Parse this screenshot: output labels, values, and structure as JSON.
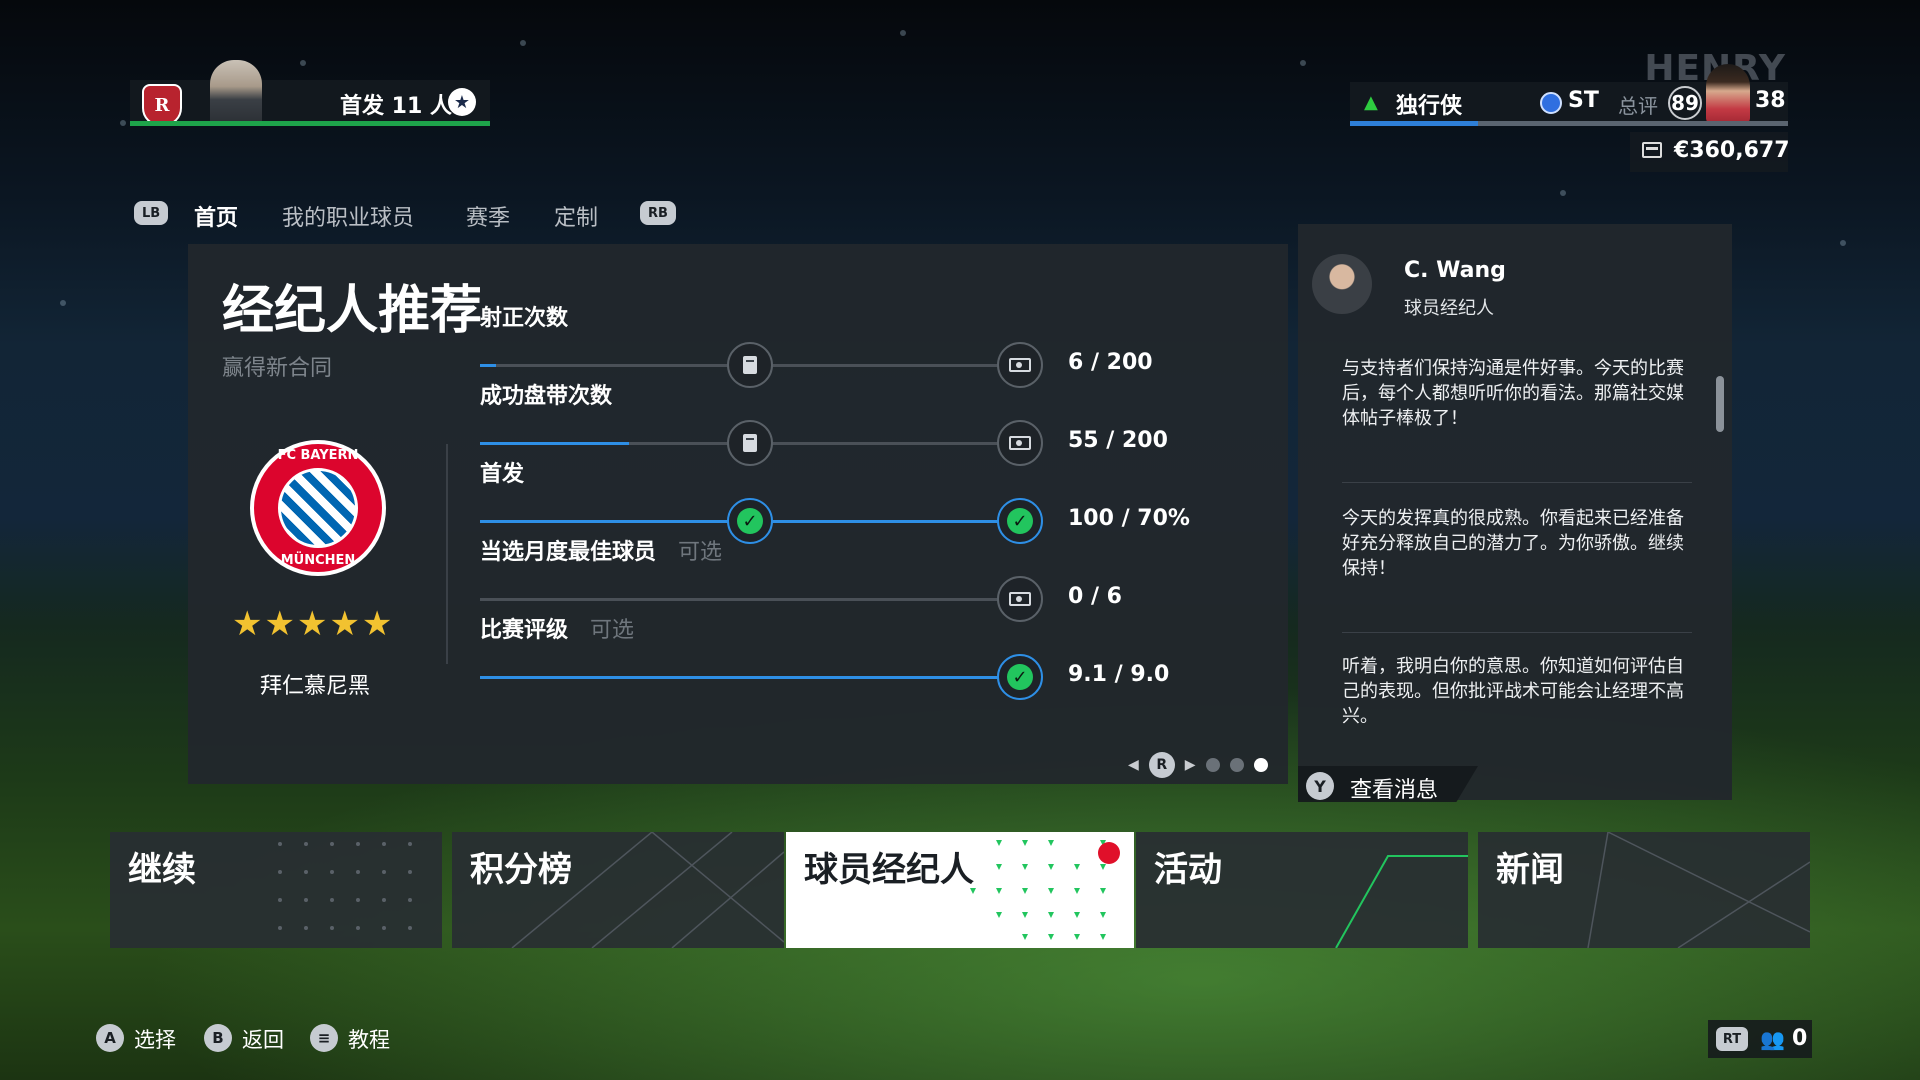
{
  "top_left": {
    "club_crest_text": "R",
    "squad_label": "首发 11 人"
  },
  "top_right": {
    "player_name": "HENRY",
    "archetype": "独行侠",
    "position": "ST",
    "ovr_label": "总评",
    "ovr_value": "89",
    "age": "38",
    "wallet": "€360,677"
  },
  "nav": {
    "lb": "LB",
    "rb": "RB",
    "tabs": [
      "首页",
      "我的职业球员",
      "赛季",
      "定制"
    ]
  },
  "objectives_panel": {
    "title": "经纪人推荐",
    "subtitle": "赢得新合同",
    "club_name": "拜仁慕尼黑",
    "club_logo_top": "FC BAYERN",
    "club_logo_bottom": "MÜNCHEN",
    "club_rating": 5,
    "club_stars_text": "★★★★★",
    "objectives": [
      {
        "label": "射正次数",
        "optional": "",
        "progress": "6 / 200",
        "fraction": 0.03,
        "completed": false
      },
      {
        "label": "成功盘带次数",
        "optional": "",
        "progress": "55 / 200",
        "fraction": 0.275,
        "completed": false
      },
      {
        "label": "首发",
        "optional": "",
        "progress": "100 / 70%",
        "fraction": 1.0,
        "completed": true
      },
      {
        "label": "当选月度最佳球员",
        "optional": "可选",
        "progress": "0 / 6",
        "fraction": 0.0,
        "completed": false
      },
      {
        "label": "比赛评级",
        "optional": "可选",
        "progress": "9.1 / 9.0",
        "fraction": 1.0,
        "completed": true
      }
    ],
    "page_button": "R",
    "page_count": 3,
    "page_active": 3
  },
  "agent": {
    "name": "C. Wang",
    "role": "球员经纪人",
    "messages": [
      "与支持者们保持沟通是件好事。今天的比赛后，每个人都想听听你的看法。那篇社交媒体帖子棒极了！",
      "今天的发挥真的很成熟。你看起来已经准备好充分释放自己的潜力了。为你骄傲。继续保持！",
      "听着，我明白你的意思。你知道如何评估自己的表现。但你批评战术可能会让经理不高兴。"
    ],
    "view_button": "Y",
    "view_label": "查看消息"
  },
  "tiles": [
    "继续",
    "积分榜",
    "球员经纪人",
    "活动",
    "新闻"
  ],
  "hints": [
    {
      "button": "A",
      "label": "选择"
    },
    {
      "button": "B",
      "label": "返回"
    },
    {
      "button": "≡",
      "label": "教程"
    }
  ],
  "bottom_right": {
    "rt": "RT",
    "friends_count": "0"
  },
  "colors": {
    "accent_blue": "#2e8fe6",
    "success_green": "#22c55e",
    "notification_red": "#e0102a",
    "star_gold": "#f2c230"
  }
}
